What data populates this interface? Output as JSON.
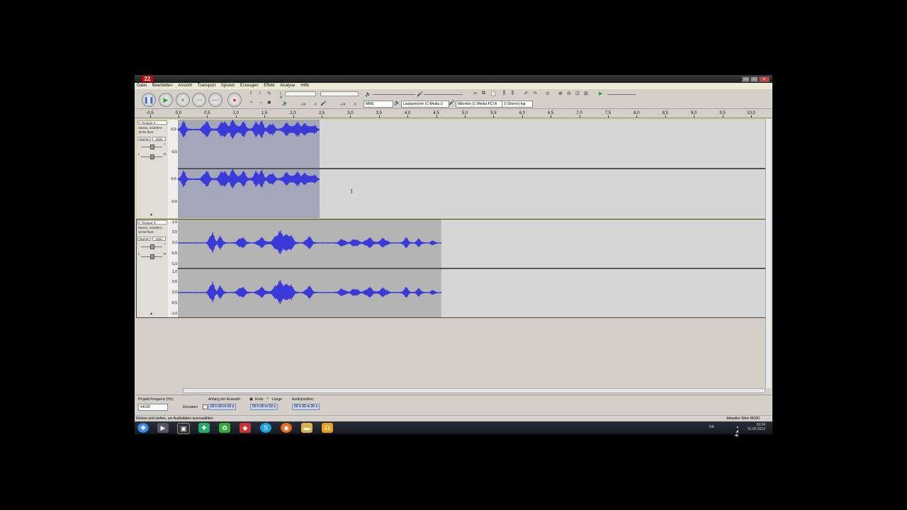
{
  "window": {
    "icon_text": "22",
    "buttons": [
      "—",
      "□",
      "x"
    ]
  },
  "menu": [
    "Datei",
    "Bearbeiten",
    "Ansicht",
    "Transport",
    "Spuren",
    "Erzeugen",
    "Effekt",
    "Analyse",
    "Hilfe"
  ],
  "toolbar": {
    "pause_icon": "pause-icon",
    "play_icon": "play-icon",
    "stop_icon": "stop-icon",
    "meter_left_label": "L",
    "meter_right_label": "R",
    "meter_value_a": "-24",
    "meter_value_b": "0",
    "meter_value_c": "-24",
    "meter_value_d": "0",
    "host": "MME",
    "output_device": "Lautsprecher (C-Media U",
    "input_device": "Mikrofon (C-Media PCI A",
    "channels": "2 (Stereo) Inp"
  },
  "ruler": {
    "ticks": [
      "-0,5",
      "0,0",
      "0,5",
      "1,0",
      "1,5",
      "2,0",
      "2,5",
      "3,0",
      "3,5",
      "4,0",
      "4,5",
      "5,0",
      "5,5",
      "6,0",
      "6,5",
      "7,0",
      "7,5",
      "8,0",
      "8,5",
      "9,0",
      "9,5",
      "10,0"
    ]
  },
  "tracks": [
    {
      "name": "Tonspur",
      "info_line1": "Stereo, 44100Hz",
      "info_line2": "32-bit float",
      "mute": "Stumm",
      "solo": "Solo",
      "gain_minus": "-",
      "gain_plus": "+",
      "pan_l": "L",
      "pan_r": "R",
      "scale_ch1": [
        "0,0-",
        "-0,5"
      ],
      "scale_ch2": [
        "0,0-",
        "-0,5"
      ]
    },
    {
      "name": "Tonspur",
      "info_line1": "Stereo, 44100Hz",
      "info_line2": "32-bit float",
      "mute": "Stumm",
      "solo": "Solo",
      "gain_minus": "-",
      "gain_plus": "+",
      "pan_l": "L",
      "pan_r": "R",
      "scale_ch1": [
        "1,0",
        "0,5",
        "0,0",
        "-0,5",
        "-1,0"
      ],
      "scale_ch2": [
        "1,0",
        "0,5",
        "0,0",
        "-0,5",
        "-1,0"
      ]
    }
  ],
  "cursor_glyph": "I",
  "bottom": {
    "rate_label": "Projekt-Frequenz (Hz):",
    "rate_value": "44100",
    "snap_label": "Einrasten",
    "sel_start_label": "Anfang der Auswahl:",
    "end_label": "Ende",
    "length_label": "Länge",
    "audio_pos_label": "Audioposition:",
    "sel_start_value": "00 h 00 m 00 s",
    "sel_end_value": "00 h 00 m 02 s",
    "audio_pos_value": "00 h 00 m 00 s"
  },
  "status": {
    "hint": "Klicken und ziehen, um Audiodaten auszuwählen",
    "value": "Aktueller Wert 44100"
  },
  "taskbar": {
    "lang": "DE",
    "time": "15:34",
    "date": "01.03.2012"
  }
}
